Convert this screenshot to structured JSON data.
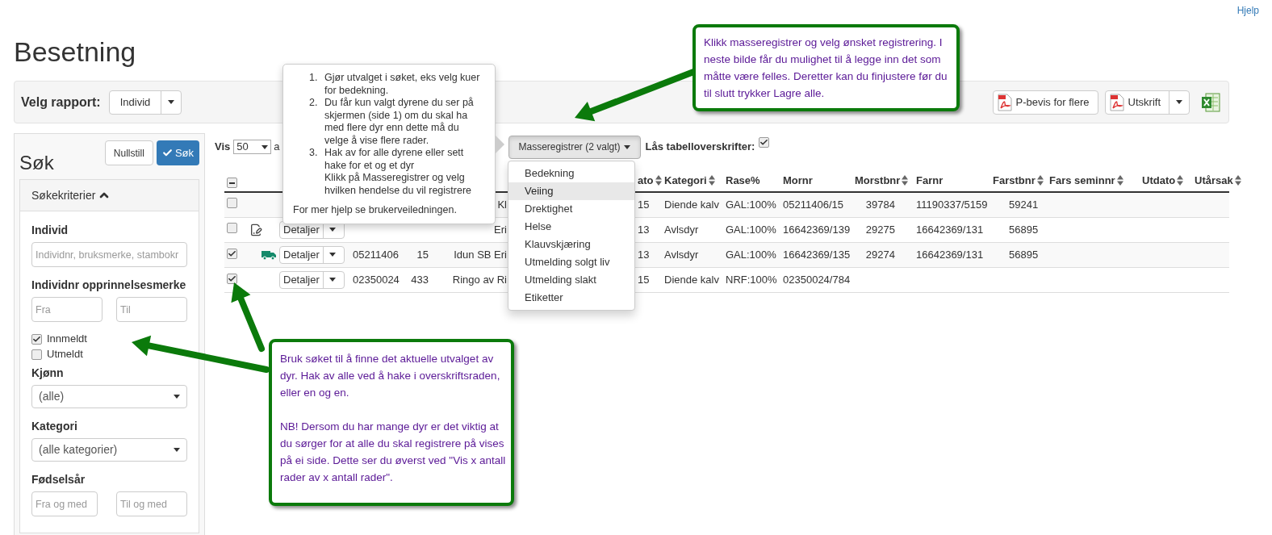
{
  "help_link": "Hjelp",
  "title": "Besetning",
  "report_bar": {
    "label": "Velg rapport:",
    "report": "Individ",
    "buttons": [
      {
        "label": "P-bevis for flere",
        "kind": "pdf",
        "split": false
      },
      {
        "label": "Utskrift",
        "kind": "pdf",
        "split": true
      }
    ],
    "export": {
      "kind": "excel"
    }
  },
  "search": {
    "title": "Søk",
    "reset_button": "Nullstill",
    "search_button": "Søk",
    "criteria": {
      "title": "Søkekriterier",
      "expanded": true
    },
    "individ": {
      "label": "Individ",
      "placeholder": "Individnr, bruksmerke, stambokr"
    },
    "origin": {
      "label": "Individnr opprinnelsesmerke",
      "from_placeholder": "Fra",
      "to_placeholder": "Til"
    },
    "status": [
      {
        "label": "Innmeldt",
        "checked": true
      },
      {
        "label": "Utmeldt",
        "checked": false
      }
    ],
    "sex": {
      "label": "Kjønn",
      "value": "(alle)"
    },
    "category": {
      "label": "Kategori",
      "value": "(alle kategorier)"
    },
    "birth_year": {
      "label": "Fødselsår",
      "from_placeholder": "Fra og med",
      "to_placeholder": "Til og med"
    }
  },
  "toolbar": {
    "show_label": "Vis",
    "page_size": "50",
    "show_suffix": "a",
    "mass_button": "Masseregistrer (2 valgt)",
    "lock_label": "Lås tabelloverskrifter:",
    "lock_checked": true
  },
  "mass_menu": {
    "open": true,
    "items": [
      {
        "label": "Bedekning",
        "selected": false
      },
      {
        "label": "Veiing",
        "selected": true
      },
      {
        "label": "Drektighet",
        "selected": false
      },
      {
        "label": "Helse",
        "selected": false
      },
      {
        "label": "Klauvskjæring",
        "selected": false
      },
      {
        "label": "Utmelding solgt liv",
        "selected": false
      },
      {
        "label": "Utmelding slakt",
        "selected": false
      },
      {
        "label": "Etiketter",
        "selected": false
      }
    ]
  },
  "table": {
    "select_all_indeterminate": true,
    "columns": [
      {
        "label": "ato",
        "sortable": true
      },
      {
        "label": "Kategori",
        "sortable": true
      },
      {
        "label": "Rase%",
        "sortable": false
      },
      {
        "label": "Mornr",
        "sortable": false
      },
      {
        "label": "Morstbnr",
        "sortable": true
      },
      {
        "label": "Farnr",
        "sortable": false
      },
      {
        "label": "Farstbnr",
        "sortable": true
      },
      {
        "label": "Fars seminnr",
        "sortable": true
      },
      {
        "label": "Utdato",
        "sortable": true
      },
      {
        "label": "Utårsak",
        "sortable": true
      }
    ],
    "rows": [
      {
        "checked": false,
        "kind": "plain",
        "name": "Kl",
        "cells": [
          "15",
          "Diende kalv",
          "GAL:100%",
          "05211406/15",
          "39784",
          "11190337/5159",
          "59241"
        ]
      },
      {
        "checked": false,
        "kind": "edit",
        "details": "Detaljer",
        "name": "Eri",
        "cells": [
          "13",
          "Avlsdyr",
          "GAL:100%",
          "16642369/139",
          "29275",
          "16642369/131",
          "56895"
        ]
      },
      {
        "checked": true,
        "kind": "truck",
        "details": "Detaljer",
        "id": "05211406",
        "number": "15",
        "name": "Idun SB Eri",
        "cells": [
          "13",
          "Avlsdyr",
          "GAL:100%",
          "16642369/135",
          "29274",
          "16642369/131",
          "56895"
        ]
      },
      {
        "checked": true,
        "kind": "plain",
        "details": "Detaljer",
        "id": "02350024",
        "number": "433",
        "name": "Ringo av Ri",
        "cells": [
          "15",
          "Diende kalv",
          "NRF:100%",
          "02350024/784"
        ]
      }
    ]
  },
  "help_popover": {
    "steps": [
      {
        "marker": "1.",
        "lines": [
          "Gjør utvalget i søket, eks velg kuer for bedekning."
        ]
      },
      {
        "marker": "2.",
        "lines": [
          "Du får kun valgt dyrene du ser på skjermen (side 1) om du skal ha med flere dyr enn dette må du velge å vise flere rader."
        ]
      },
      {
        "marker": "3.",
        "lines": [
          "Hak av for alle dyrene eller sett hake for et og et dyr",
          "Klikk på Masseregistrer og velg hvilken hendelse du vil registrere"
        ]
      }
    ],
    "footer": "For mer hjelp se brukerveiledningen."
  },
  "callouts": [
    {
      "kind": "top",
      "paragraphs": [
        "Klikk masseregistrer og velg ønsket registrering. I neste bilde får du mulighet til å legge inn det som måtte være felles. Deretter kan du finjustere før du til slutt trykker Lagre alle."
      ]
    },
    {
      "kind": "bottom",
      "paragraphs": [
        "Bruk søket til å finne det aktuelle utvalget av dyr. Hak av alle ved å hake i overskriftsraden, eller en og en.",
        "NB! Dersom du har mange dyr er det viktig at du sørger for at alle du skal registrere på vises på ei side. Dette ser du øverst ved \"Vis x antall rader av x antall rader\"."
      ]
    }
  ]
}
